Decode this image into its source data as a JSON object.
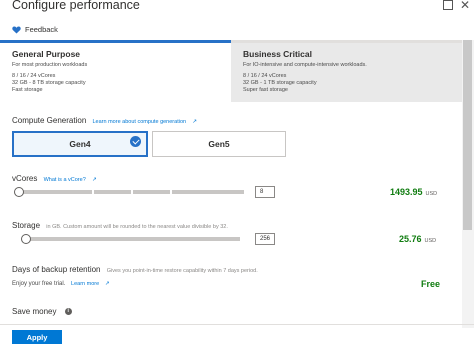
{
  "window": {
    "title": "Configure performance"
  },
  "feedback": {
    "label": "Feedback"
  },
  "tiers": [
    {
      "name": "General Purpose",
      "description": "For most production workloads",
      "lines": [
        "8 / 16 / 24 vCores",
        "32 GB - 8 TB storage capacity",
        "Fast storage"
      ],
      "selected": true
    },
    {
      "name": "Business Critical",
      "description": "For IO-intensive and compute-intensive workloads.",
      "lines": [
        "8 / 16 / 24 vCores",
        "32 GB - 1 TB storage capacity",
        "Super fast storage"
      ],
      "selected": false
    }
  ],
  "compute": {
    "label": "Compute Generation",
    "link": "Learn more about compute generation",
    "options": [
      {
        "label": "Gen4",
        "selected": true
      },
      {
        "label": "Gen5",
        "selected": false
      }
    ]
  },
  "vcores": {
    "label": "vCores",
    "link": "What is a vCore?",
    "value": "8",
    "level": 0,
    "price": "1493.95",
    "currency": "USD"
  },
  "storage": {
    "label": "Storage",
    "hint": "in GB. Custom amount will be rounded to the nearest value divisible by 32.",
    "value": "256",
    "level": 0,
    "price": "25.76",
    "currency": "USD"
  },
  "backup": {
    "label": "Days of backup retention",
    "hint": "Gives you point-in-time restore capability within 7 days period.",
    "trial_text": "Enjoy your free trial.",
    "link": "Learn more",
    "price": "Free"
  },
  "save_money": {
    "label": "Save money"
  },
  "footer": {
    "apply_label": "Apply"
  },
  "colors": {
    "accent": "#0078d4",
    "price_green": "#107c10",
    "selected_border": "#2771c7"
  }
}
